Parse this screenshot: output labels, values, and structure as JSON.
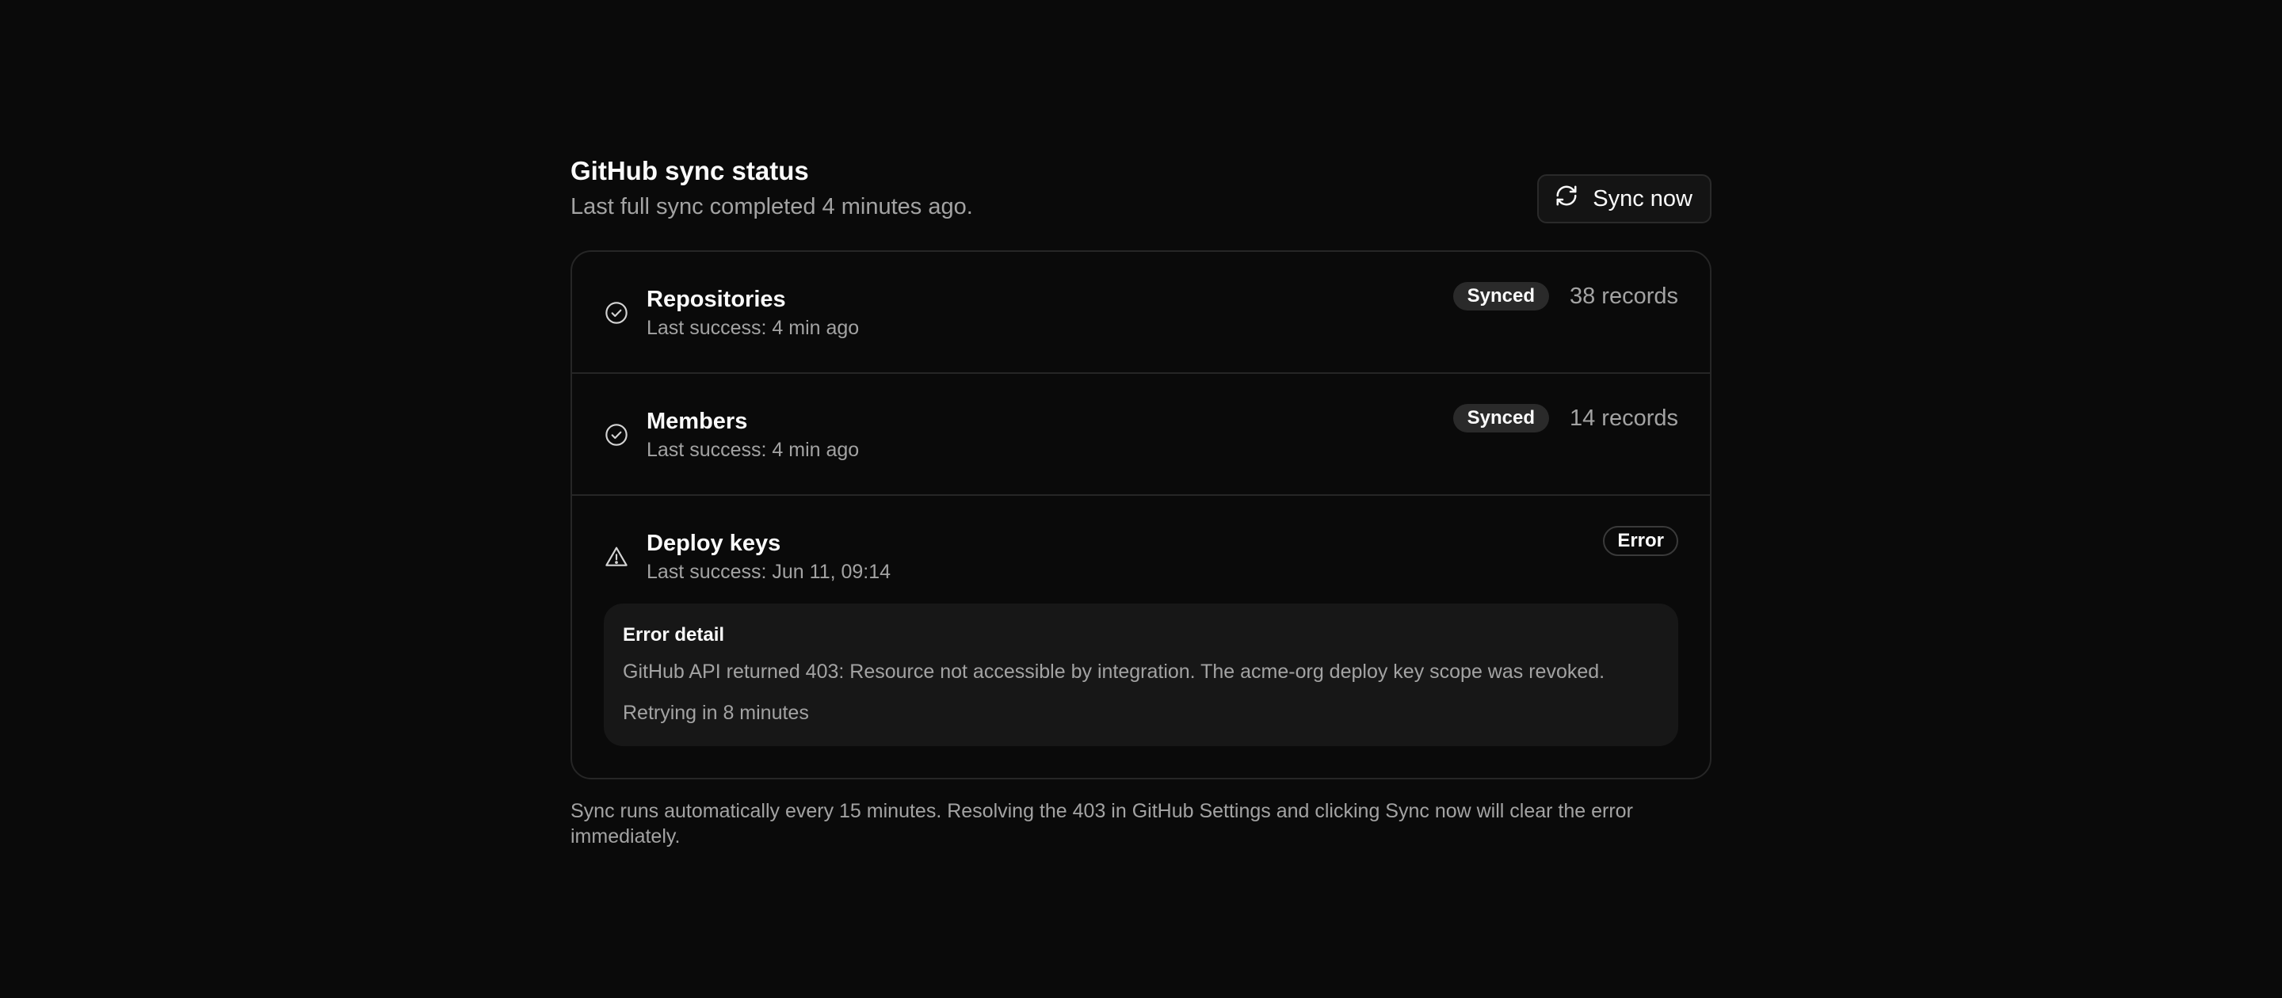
{
  "header": {
    "title": "GitHub sync status",
    "subtitle": "Last full sync completed 4 minutes ago.",
    "sync_button_label": "Sync now"
  },
  "rows": [
    {
      "name": "Repositories",
      "last_success": "Last success: 4 min ago",
      "status": "Synced",
      "records": "38 records",
      "icon": "check-circle-icon"
    },
    {
      "name": "Members",
      "last_success": "Last success: 4 min ago",
      "status": "Synced",
      "records": "14 records",
      "icon": "check-circle-icon"
    },
    {
      "name": "Deploy keys",
      "last_success": "Last success: Jun 11, 09:14",
      "status": "Error",
      "icon": "warning-triangle-icon",
      "error": {
        "title": "Error detail",
        "message": "GitHub API returned 403: Resource not accessible by integration. The acme-org deploy key scope was revoked.",
        "retry": "Retrying in 8 minutes"
      }
    }
  ],
  "footnote": "Sync runs automatically every 15 minutes. Resolving the 403 in GitHub Settings and clicking Sync now will clear the error immediately.",
  "colors": {
    "background": "#0a0a0a",
    "card_border": "#262626",
    "muted_text": "#a3a3a3",
    "badge_bg": "#2a2a2a"
  }
}
